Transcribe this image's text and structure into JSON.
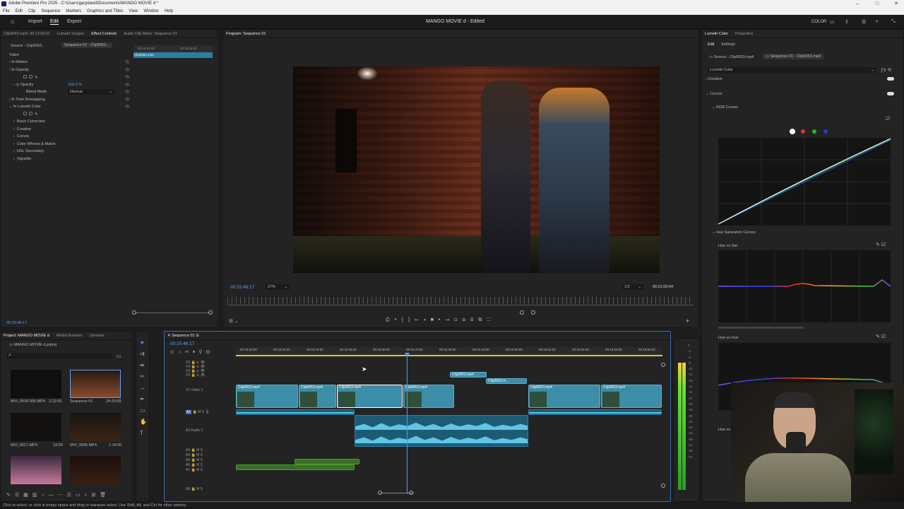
{
  "titlebar": {
    "title": "Adobe Premiere Pro 2025 - C:\\Users\\garydavid\\Documents\\MANGO MOVIE d *"
  },
  "menu": [
    "File",
    "Edit",
    "Clip",
    "Sequence",
    "Markers",
    "Graphics and Titles",
    "View",
    "Window",
    "Help"
  ],
  "header": {
    "import": "Import",
    "edit": "Edit",
    "export": "Export",
    "project_title": "MANGO MOVIE d - Edited",
    "workspace": "COLOR"
  },
  "effect_controls": {
    "tabs": [
      "Clip0043.mp4: 00:13:06:01",
      "Lumetri Scopes",
      "Effect Controls",
      "Audio Clip Mixer: Sequence 01"
    ],
    "source_tab": "Source - Clip0053...",
    "seq_tab": "Sequence 01 - Clip0053...",
    "ruler_a": "00:15:45:00",
    "ruler_b": "00:15:46:00",
    "clip_label": "Clip0053.mp4",
    "video_label": "Video",
    "motion": "Motion",
    "opacity": "Opacity",
    "opacity_param": "Opacity",
    "opacity_value": "100.0 %",
    "blend_mode": "Blend Mode",
    "blend_value": "Normal",
    "time_remap": "Time Remapping",
    "lumetri": "Lumetri Color",
    "basic": "Basic Correction",
    "creative": "Creative",
    "curves": "Curves",
    "wheels": "Color Wheels & Match",
    "hsl": "HSL Secondary",
    "vignette": "Vignette",
    "timecode": "00:15:46:17"
  },
  "program": {
    "tab": "Program: Sequence 01",
    "timecode": "00:15:46:17",
    "zoom": "27%",
    "res": "1/2",
    "duration": "00:21:00:04"
  },
  "lumetri": {
    "tabs": [
      "Lumetri Color",
      "Properties"
    ],
    "subtabs": [
      "Edit",
      "Settings"
    ],
    "src": "Source - Clip0053.mp4",
    "seq": "Sequence 01 - Clip0053.mp4",
    "dropdown": "Lumetri Color",
    "creative": "Creative",
    "curves": "Curves",
    "rgb": "RGB Curves",
    "hue_sat_curves": "Hue Saturation Curves",
    "hue_vs_sat": "Hue vs Sat",
    "hue_vs_hue": "Hue vs Hue",
    "hue_vs_l": "Hue vs L"
  },
  "project": {
    "tabs": [
      "Project: MANGO MOVIE d",
      "Media Browser",
      "Libraries"
    ],
    "file": "MANGO MOVIE d.prproj",
    "items": [
      {
        "name": "MVI_0018-005.MP4",
        "dur": "2:12:00"
      },
      {
        "name": "Sequence 01",
        "dur": "24:20:08"
      },
      {
        "name": "MVI_0017.MP4",
        "dur": "19:00"
      },
      {
        "name": "MVI_0006.MP4",
        "dur": "1:16:00"
      }
    ]
  },
  "timeline": {
    "tab": "Sequence 01",
    "timecode": "00:15:46:17",
    "ruler": [
      "00:15:42:00",
      "00:15:43:00",
      "00:15:44:00",
      "00:15:45:00",
      "00:15:46:00",
      "00:15:47:00",
      "00:15:48:00",
      "00:15:49:00",
      "00:15:50:00",
      "00:15:51:00",
      "00:15:52:00",
      "00:15:53:00",
      "00:15:54:00"
    ],
    "tracks": [
      "V5",
      "V4",
      "V3",
      "V2",
      "V1",
      "A1",
      "A2",
      "A3",
      "A4",
      "A5",
      "A6",
      "A7",
      "A8"
    ],
    "video1": "Video 1",
    "audio2": "Audio 2",
    "clips": [
      "Clip0053.mp4",
      "Clip0053.m...",
      "Clip0053.mp4",
      "Clip0053.mp4",
      "Clip0053.mp4",
      "Clip0053.mp4",
      "Clip0053.mp4",
      "Clip0053.mp4"
    ]
  },
  "meter_labels": [
    "0",
    "-3",
    "-6",
    "-9",
    "-12",
    "-15",
    "-18",
    "-21",
    "-24",
    "-27",
    "-30",
    "-33",
    "-36",
    "-39",
    "-42",
    "-45",
    "-48",
    "-51",
    "-54",
    "-57"
  ],
  "status": "Click to select, or click in empty space and drag to marquee select. Use Shift, Alt, and Ctrl for other options."
}
